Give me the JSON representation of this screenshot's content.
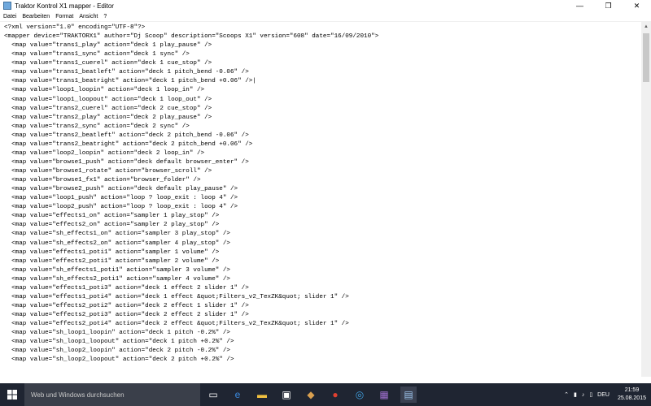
{
  "window": {
    "title": "Traktor Kontrol X1 mapper - Editor",
    "controls": {
      "minimize": "—",
      "maximize": "❐",
      "close": "✕"
    }
  },
  "menu": [
    "Datei",
    "Bearbeiten",
    "Format",
    "Ansicht",
    "?"
  ],
  "editor": {
    "lines": [
      "<?xml version=\"1.0\" encoding=\"UTF-8\"?>",
      "<mapper device=\"TRAKTORX1\" author=\"Dj Scoop\" description=\"Scoops X1\" version=\"608\" date=\"16/09/2010\">",
      "  <map value=\"trans1_play\" action=\"deck 1 play_pause\" />",
      "  <map value=\"trans1_sync\" action=\"deck 1 sync\" />",
      "  <map value=\"trans1_cuerel\" action=\"deck 1 cue_stop\" />",
      "  <map value=\"trans1_beatleft\" action=\"deck 1 pitch_bend -0.06\" />",
      "  <map value=\"trans1_beatright\" action=\"deck 1 pitch_bend +0.06\" />|",
      "  <map value=\"loop1_loopin\" action=\"deck 1 loop_in\" />",
      "  <map value=\"loop1_loopout\" action=\"deck 1 loop_out\" />",
      "  <map value=\"trans2_cuerel\" action=\"deck 2 cue_stop\" />",
      "  <map value=\"trans2_play\" action=\"deck 2 play_pause\" />",
      "  <map value=\"trans2_sync\" action=\"deck 2 sync\" />",
      "  <map value=\"trans2_beatleft\" action=\"deck 2 pitch_bend -0.06\" />",
      "  <map value=\"trans2_beatright\" action=\"deck 2 pitch_bend +0.06\" />",
      "  <map value=\"loop2_loopin\" action=\"deck 2 loop_in\" />",
      "  <map value=\"browse1_push\" action=\"deck default browser_enter\" />",
      "  <map value=\"browse1_rotate\" action=\"browser_scroll\" />",
      "  <map value=\"browse1_fx1\" action=\"browser_folder\" />",
      "  <map value=\"browse2_push\" action=\"deck default play_pause\" />",
      "  <map value=\"loop1_push\" action=\"loop ? loop_exit : loop 4\" />",
      "  <map value=\"loop2_push\" action=\"loop ? loop_exit : loop 4\" />",
      "  <map value=\"effects1_on\" action=\"sampler 1 play_stop\" />",
      "  <map value=\"effects2_on\" action=\"sampler 2 play_stop\" />",
      "  <map value=\"sh_effects1_on\" action=\"sampler 3 play_stop\" />",
      "  <map value=\"sh_effects2_on\" action=\"sampler 4 play_stop\" />",
      "  <map value=\"effects1_poti1\" action=\"sampler 1 volume\" />",
      "  <map value=\"effects2_poti1\" action=\"sampler 2 volume\" />",
      "  <map value=\"sh_effects1_poti1\" action=\"sampler 3 volume\" />",
      "  <map value=\"sh_effects2_poti1\" action=\"sampler 4 volume\" />",
      "  <map value=\"effects1_poti3\" action=\"deck 1 effect 2 slider 1\" />",
      "  <map value=\"effects1_poti4\" action=\"deck 1 effect &quot;Filters_v2_TexZK&quot; slider 1\" />",
      "  <map value=\"effects2_poti2\" action=\"deck 2 effect 1 slider 1\" />",
      "  <map value=\"effects2_poti3\" action=\"deck 2 effect 2 slider 1\" />",
      "  <map value=\"effects2_poti4\" action=\"deck 2 effect &quot;Filters_v2_TexZK&quot; slider 1\" />",
      "  <map value=\"sh_loop1_loopin\" action=\"deck 1 pitch -0.2%\" />",
      "  <map value=\"sh_loop1_loopout\" action=\"deck 1 pitch +0.2%\" />",
      "  <map value=\"sh_loop2_loopin\" action=\"deck 2 pitch -0.2%\" />",
      "  <map value=\"sh_loop2_loopout\" action=\"deck 2 pitch +0.2%\" />"
    ]
  },
  "taskbar": {
    "search_placeholder": "Web und Windows durchsuchen",
    "language": "DEU",
    "time": "21:59",
    "date": "25.08.2015"
  }
}
